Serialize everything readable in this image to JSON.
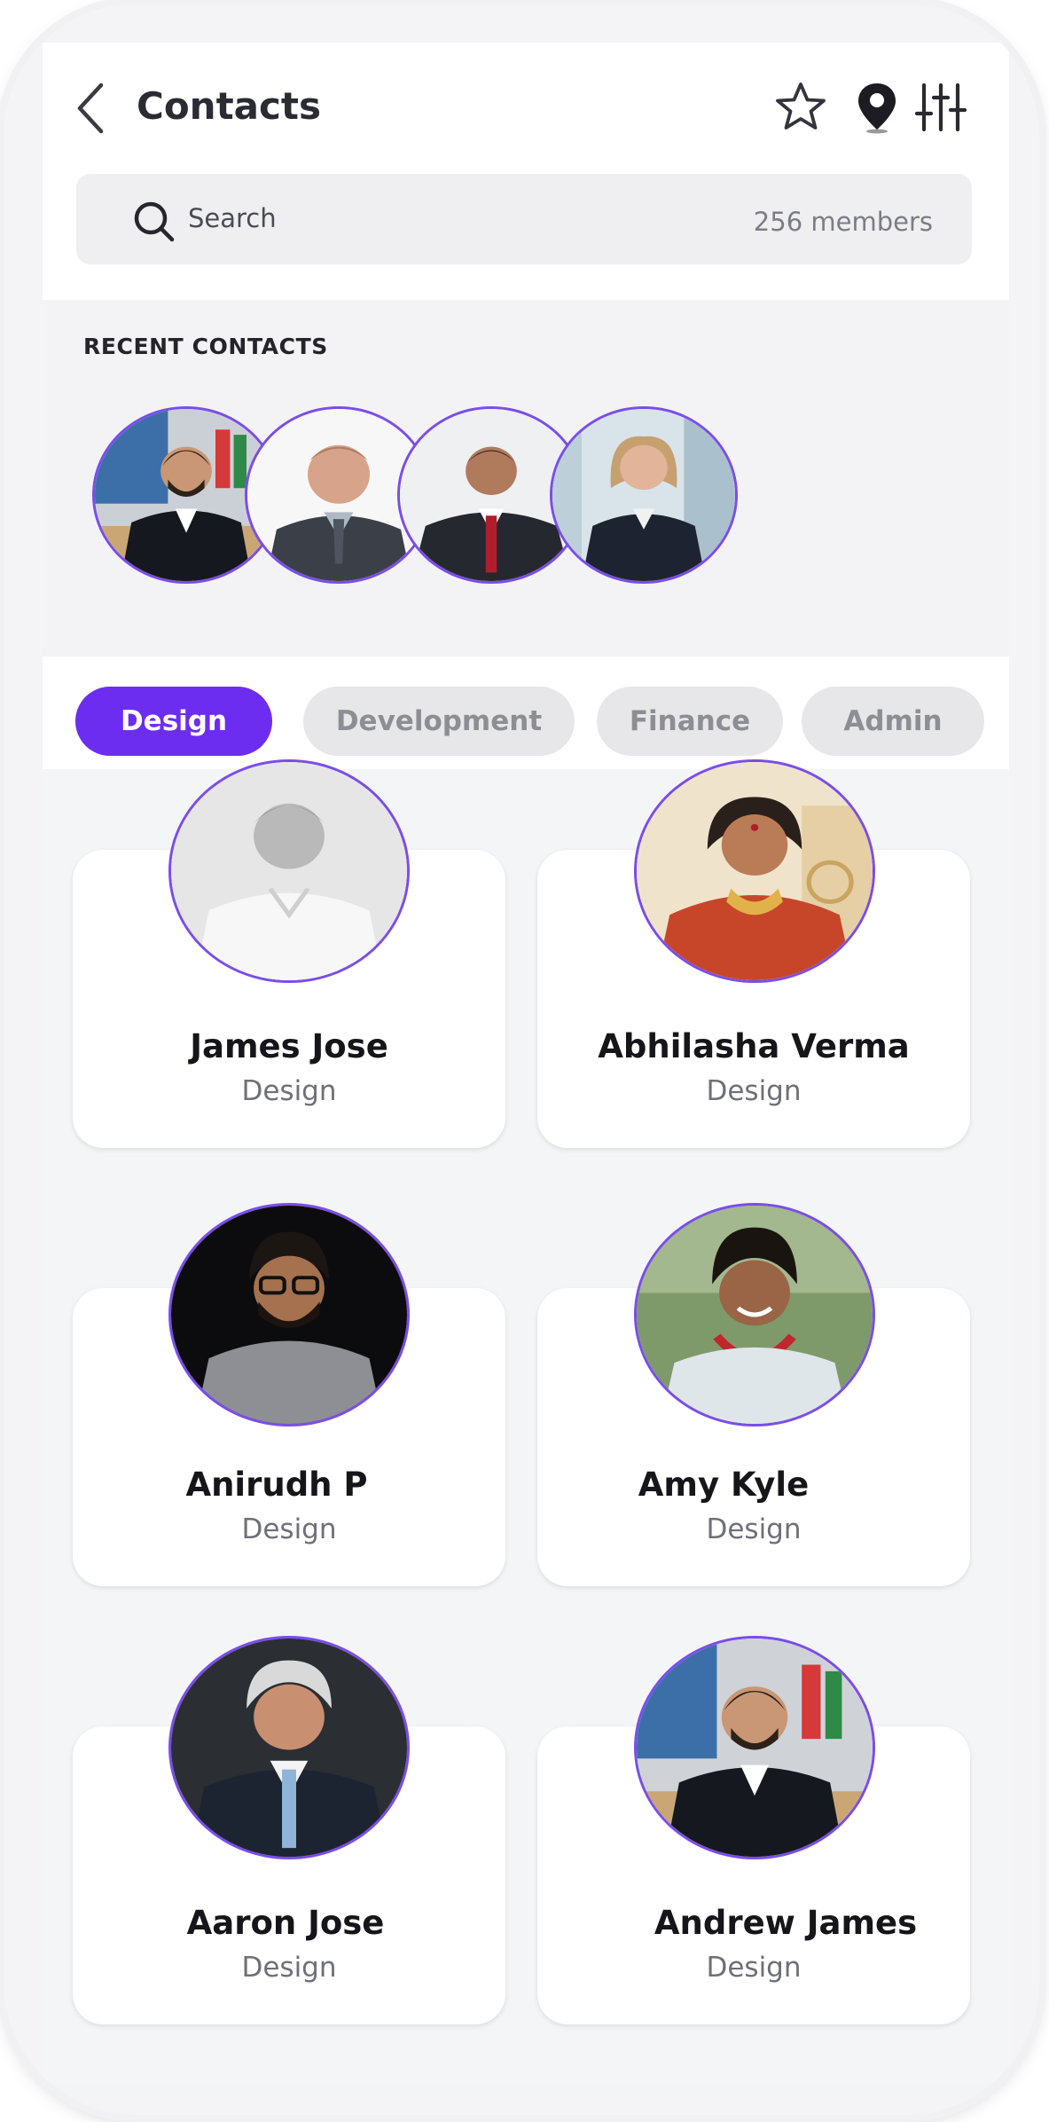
{
  "header": {
    "title": "Contacts",
    "search_placeholder": "Search",
    "member_count": "256 members"
  },
  "recent": {
    "title": "RECENT CONTACTS"
  },
  "chips": [
    {
      "label": "Design",
      "active": true
    },
    {
      "label": "Development",
      "active": false
    },
    {
      "label": "Finance",
      "active": false
    },
    {
      "label": "Admin",
      "active": false
    }
  ],
  "contacts": [
    {
      "name": "James Jose",
      "department": "Design"
    },
    {
      "name": "Abhilasha Verma",
      "department": "Design"
    },
    {
      "name": "Anirudh P",
      "department": "Design"
    },
    {
      "name": "Amy Kyle",
      "department": "Design"
    },
    {
      "name": "Aaron Jose",
      "department": "Design"
    },
    {
      "name": "Andrew James",
      "department": "Design"
    }
  ],
  "colors": {
    "accent": "#6c2df0",
    "avatar_border": "#7a4dea",
    "chip_idle": "#e7e7e9",
    "background": "#f4f5f7"
  },
  "icons": [
    "back-chevron-icon",
    "star-icon",
    "location-pin-icon",
    "filter-sliders-icon",
    "search-icon"
  ]
}
